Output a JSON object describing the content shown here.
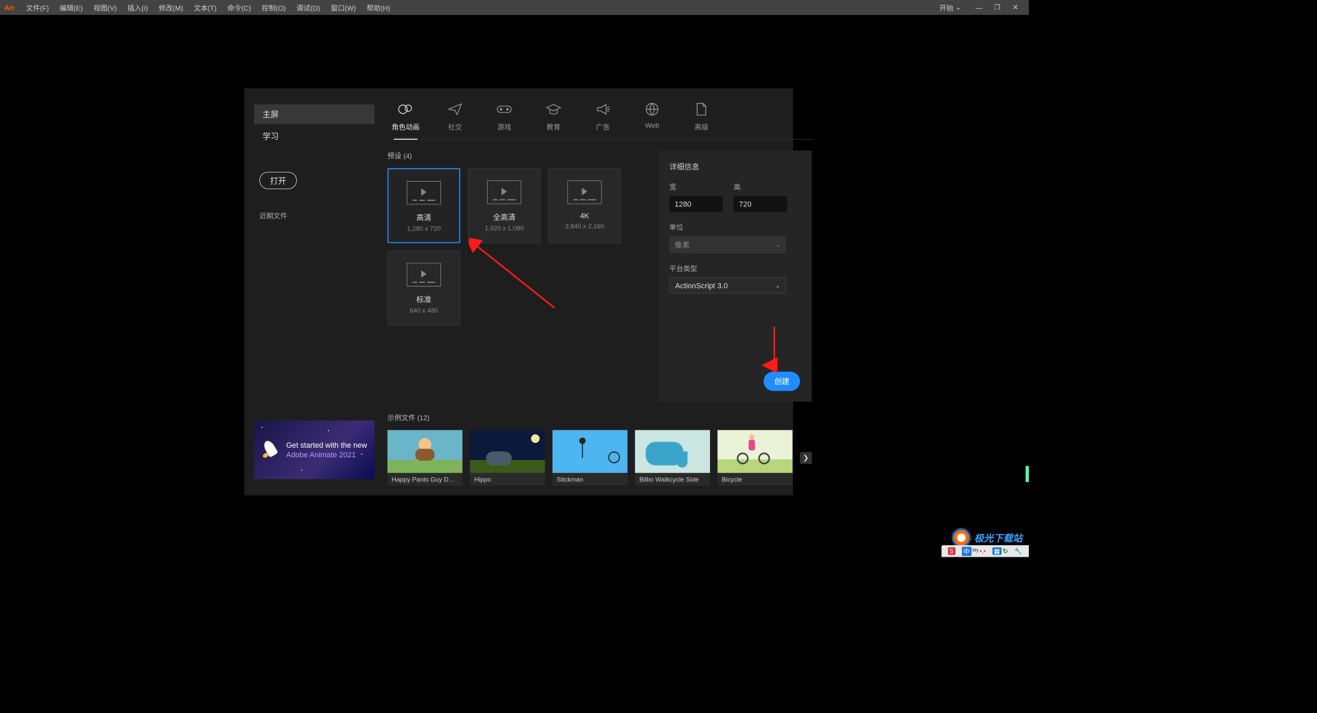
{
  "menubar": {
    "logo": "An",
    "items": [
      "文件(F)",
      "编辑(E)",
      "视图(V)",
      "插入(I)",
      "修改(M)",
      "文本(T)",
      "命令(C)",
      "控制(O)",
      "调试(D)",
      "窗口(W)",
      "帮助(H)"
    ],
    "start": "开始"
  },
  "sidebar": {
    "home": "主屏",
    "learn": "学习",
    "open": "打开",
    "recent": "近期文件"
  },
  "promo": {
    "line1": "Get started with the new",
    "line2": "Adobe Animate 2021"
  },
  "categories": [
    {
      "key": "character",
      "label": "角色动画"
    },
    {
      "key": "social",
      "label": "社交"
    },
    {
      "key": "game",
      "label": "游戏"
    },
    {
      "key": "edu",
      "label": "教育"
    },
    {
      "key": "ads",
      "label": "广告"
    },
    {
      "key": "web",
      "label": "Web"
    },
    {
      "key": "advanced",
      "label": "高级"
    }
  ],
  "presets": {
    "title": "预设 (4)",
    "cards": [
      {
        "name": "高清",
        "dim": "1,280 x 720"
      },
      {
        "name": "全高清",
        "dim": "1,920 x 1,080"
      },
      {
        "name": "4K",
        "dim": "3,840 x 2,160"
      },
      {
        "name": "标准",
        "dim": "640 x 480"
      }
    ]
  },
  "details": {
    "title": "详细信息",
    "widthLabel": "宽",
    "width": "1280",
    "heightLabel": "高",
    "height": "720",
    "unitLabel": "单位",
    "unit": "像素",
    "platformLabel": "平台类型",
    "platform": "ActionScript 3.0",
    "create": "创建"
  },
  "samples": {
    "title": "示例文件 (12)",
    "items": [
      "Happy Pants Guy Dance",
      "Hippo",
      "Stickman",
      "Bilbo Walkcycle Side",
      "Bicycle"
    ]
  }
}
